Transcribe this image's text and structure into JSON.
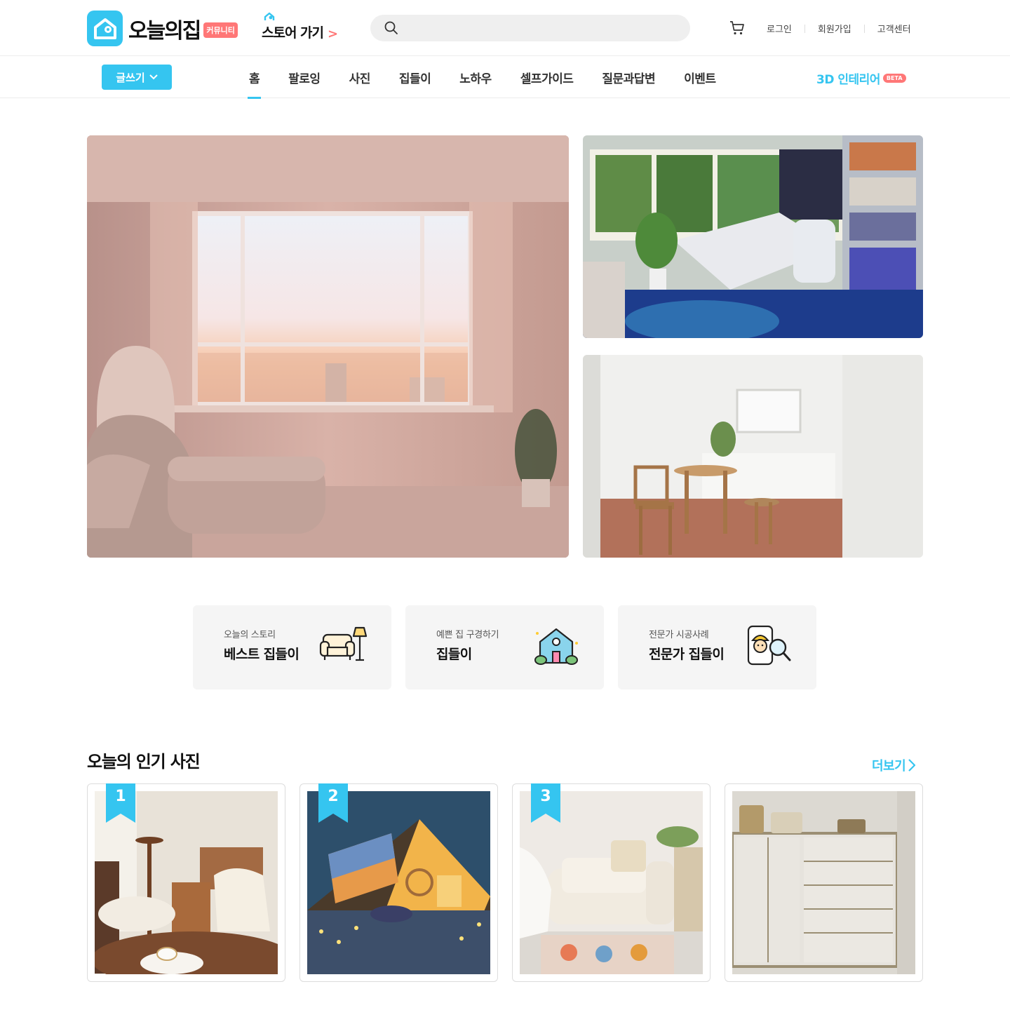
{
  "header": {
    "logo_text": "오늘의집",
    "logo_badge": "커뮤니티",
    "store_link": "스토어 가기",
    "search_placeholder": "",
    "util_links": [
      "로그인",
      "회원가입",
      "고객센터"
    ]
  },
  "nav": {
    "write_button": "글쓰기",
    "tabs": [
      "홈",
      "팔로잉",
      "사진",
      "집들이",
      "노하우",
      "셀프가이드",
      "질문과답변",
      "이벤트"
    ],
    "active_tab": "홈",
    "interior_3d": "3D 인테리어",
    "interior_badge": "BETA"
  },
  "categories": [
    {
      "sub": "오늘의 스토리",
      "title": "베스트 집들이",
      "icon": "sofa-lamp-icon"
    },
    {
      "sub": "예쁜 집 구경하기",
      "title": "집들이",
      "icon": "house-icon"
    },
    {
      "sub": "전문가 시공사례",
      "title": "전문가 집들이",
      "icon": "expert-search-icon"
    }
  ],
  "popular": {
    "title": "오늘의 인기 사진",
    "more": "더보기",
    "ranks": [
      "1",
      "2",
      "3"
    ]
  },
  "colors": {
    "accent": "#35c5f0",
    "badge": "#ff7777"
  }
}
